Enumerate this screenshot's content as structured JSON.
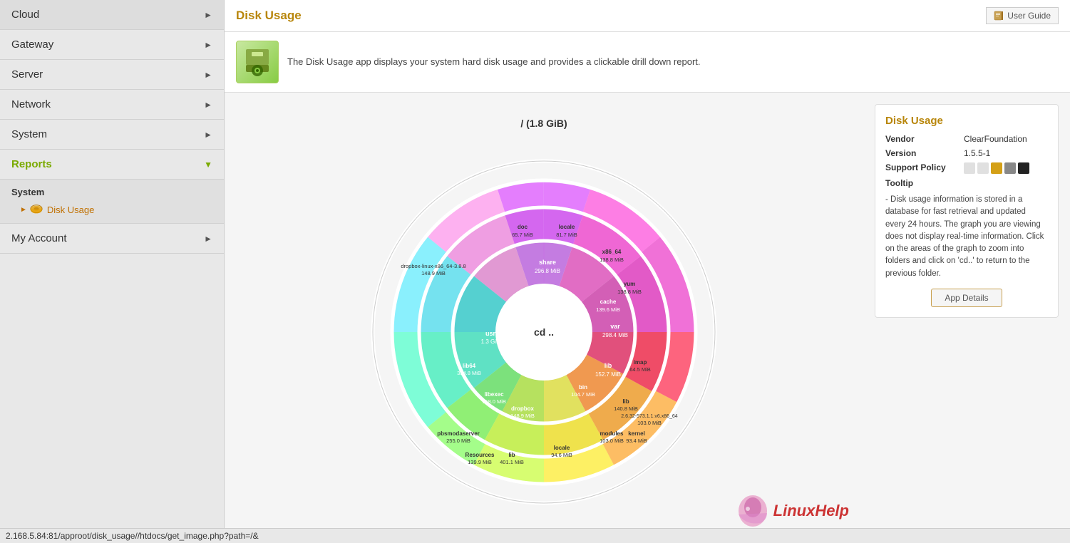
{
  "sidebar": {
    "items": [
      {
        "id": "cloud",
        "label": "Cloud",
        "hasArrow": true,
        "arrowDir": "right"
      },
      {
        "id": "gateway",
        "label": "Gateway",
        "hasArrow": true,
        "arrowDir": "right"
      },
      {
        "id": "server",
        "label": "Server",
        "hasArrow": true,
        "arrowDir": "right"
      },
      {
        "id": "network",
        "label": "Network",
        "hasArrow": true,
        "arrowDir": "right"
      },
      {
        "id": "system",
        "label": "System",
        "hasArrow": true,
        "arrowDir": "right"
      },
      {
        "id": "reports",
        "label": "Reports",
        "hasArrow": true,
        "arrowDir": "down",
        "active": true
      },
      {
        "id": "my-account",
        "label": "My Account",
        "hasArrow": true,
        "arrowDir": "right"
      }
    ],
    "submenu": {
      "group": "System",
      "activeItem": "Disk Usage",
      "items": [
        "Disk Usage"
      ]
    }
  },
  "header": {
    "title": "Disk Usage",
    "userGuide": "User Guide"
  },
  "description": {
    "text": "The Disk Usage app displays your system hard disk usage and provides a clickable drill down report."
  },
  "chart": {
    "centerLabel": "cd ..",
    "rootLabel": "/ (1.8 GiB)",
    "segments": [
      {
        "label": "usr",
        "value": "1.3 GiB"
      },
      {
        "label": "lib64",
        "value": "334.8 MiB"
      },
      {
        "label": "libexec",
        "value": "158.0 MiB"
      },
      {
        "label": "dropbox",
        "value": "148.9 MiB"
      },
      {
        "label": "dropbox-linux-x86_64-3.8.8",
        "value": "148.9 MiB"
      },
      {
        "label": "doc",
        "value": "65.7 MiB"
      },
      {
        "label": "locale",
        "value": "81.7 MiB"
      },
      {
        "label": "share",
        "value": "296.8 MiB"
      },
      {
        "label": "x86_64",
        "value": "138.8 MiB"
      },
      {
        "label": "yum",
        "value": "138.8 MiB"
      },
      {
        "label": "cache",
        "value": "139.6 MiB"
      },
      {
        "label": "var",
        "value": "298.4 MiB"
      },
      {
        "label": "lib",
        "value": "152.7 MiB"
      },
      {
        "label": "imap",
        "value": "64.5 MiB"
      },
      {
        "label": "lib",
        "value": "140.8 MiB"
      },
      {
        "label": "modules",
        "value": "103.0 MiB"
      },
      {
        "label": "2.6.32-573.1.1.v6.x86_64",
        "value": "103.0 MiB"
      },
      {
        "label": "kernel",
        "value": "93.4 MiB"
      },
      {
        "label": "bin",
        "value": "104.7 MiB"
      },
      {
        "label": "locale",
        "value": "94.6 MiB"
      },
      {
        "label": "Resources",
        "value": "139.9 MiB"
      },
      {
        "label": "pbsmodaserver",
        "value": "255.0 MiB"
      },
      {
        "label": "lib",
        "value": "401.1 MiB"
      }
    ]
  },
  "infoPanel": {
    "title": "Disk Usage",
    "vendor": {
      "label": "Vendor",
      "value": "ClearFoundation"
    },
    "version": {
      "label": "Version",
      "value": "1.5.5-1"
    },
    "supportPolicy": {
      "label": "Support Policy"
    },
    "tooltip": {
      "label": "Tooltip",
      "text": "- Disk usage information is stored in a database for fast retrieval and updated every 24 hours. The graph you are viewing does not display real-time information. Click on the areas of the graph to zoom into folders and click on 'cd..' to return to the previous folder."
    },
    "appDetails": "App Details"
  },
  "supportColors": [
    "#e0e0e0",
    "#e0e0e0",
    "#d4a017",
    "#888",
    "#222"
  ],
  "statusbar": {
    "url": "2.168.5.84:81/approot/disk_usage//htdocs/get_image.php?path=/&"
  },
  "logo": {
    "text1": "Linux",
    "text2": "Help"
  }
}
